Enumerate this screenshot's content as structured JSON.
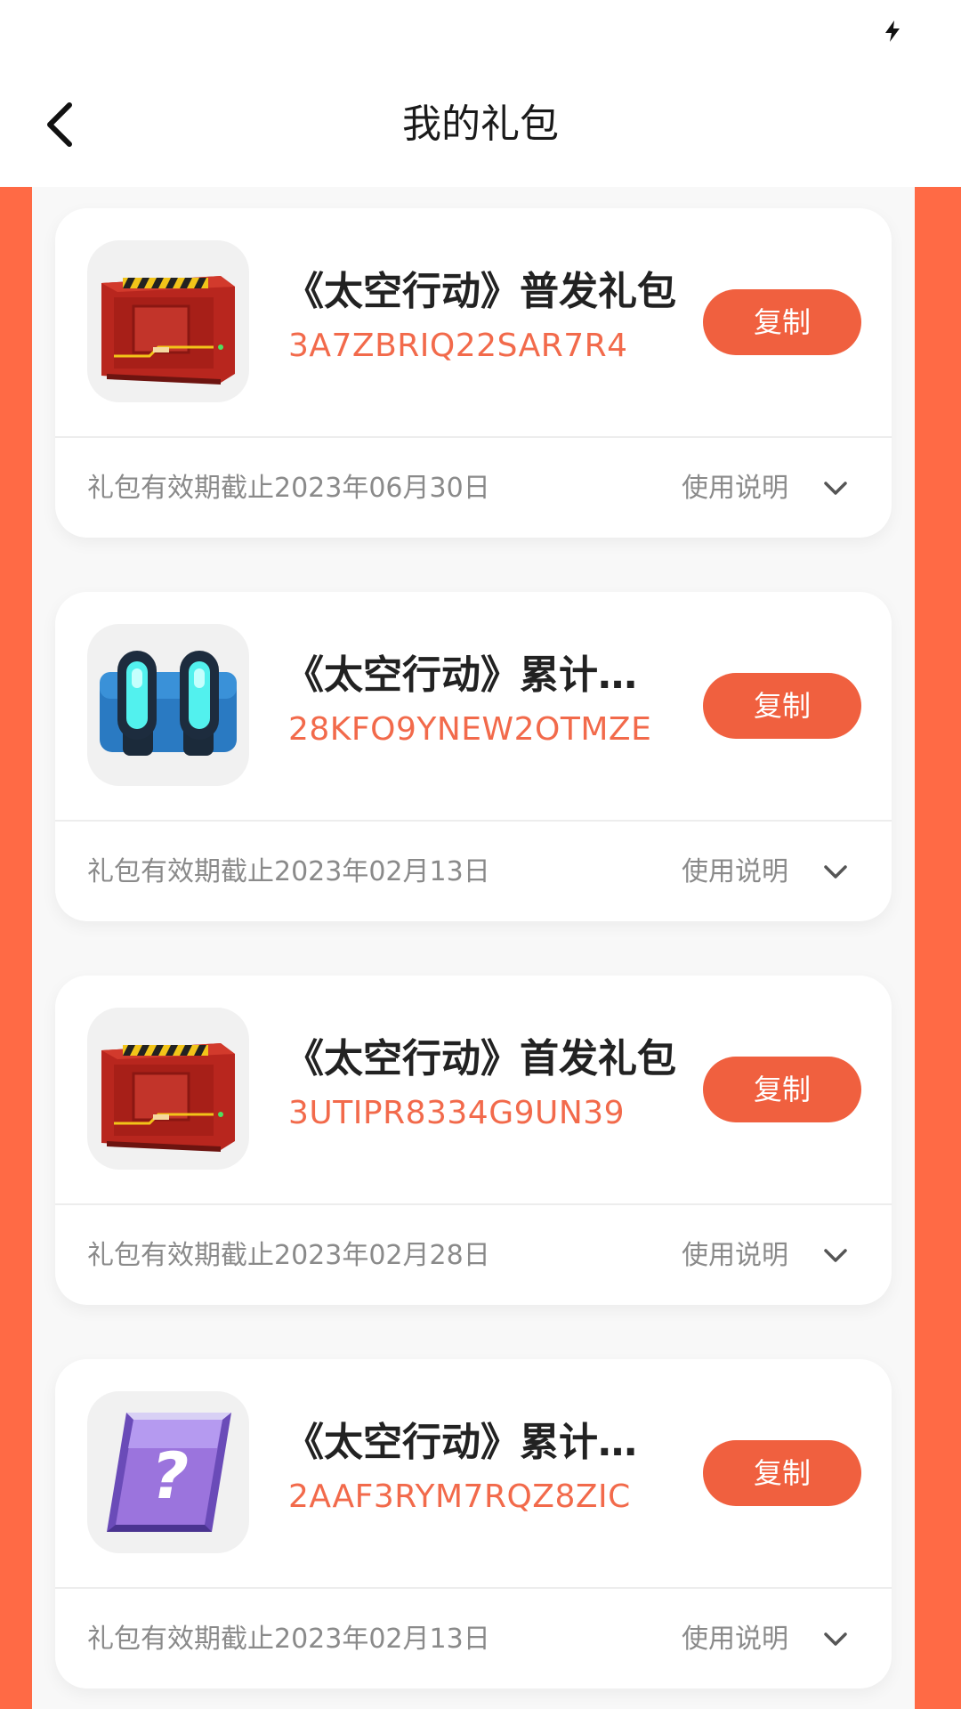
{
  "header": {
    "title": "我的礼包",
    "back_icon": "chevron-left-icon",
    "status_icon": "bolt-icon"
  },
  "colors": {
    "accent": "#f0603f",
    "background_band": "#ff6a45",
    "code_text": "#f26a4b"
  },
  "gifts": [
    {
      "title": "《太空行动》普发礼包",
      "code": "3A7ZBRIQ22SAR7R4",
      "copy_label": "复制",
      "expiry": "礼包有效期截止2023年06月30日",
      "usage_label": "使用说明",
      "icon": "red-crate-icon"
    },
    {
      "title": "《太空行动》累计…",
      "code": "28KFO9YNEW2OTMZE",
      "copy_label": "复制",
      "expiry": "礼包有效期截止2023年02月13日",
      "usage_label": "使用说明",
      "icon": "blue-thruster-icon"
    },
    {
      "title": "《太空行动》首发礼包",
      "code": "3UTIPR8334G9UN39",
      "copy_label": "复制",
      "expiry": "礼包有效期截止2023年02月28日",
      "usage_label": "使用说明",
      "icon": "red-crate-icon"
    },
    {
      "title": "《太空行动》累计…",
      "code": "2AAF3RYM7RQZ8ZIC",
      "copy_label": "复制",
      "expiry": "礼包有效期截止2023年02月13日",
      "usage_label": "使用说明",
      "icon": "mystery-card-icon"
    }
  ]
}
